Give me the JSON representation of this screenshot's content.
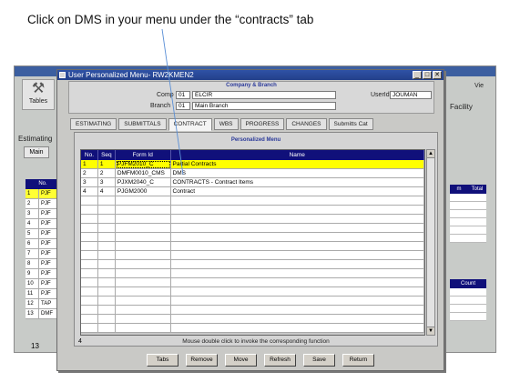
{
  "instruction": "Click on DMS in your menu under the “contracts” tab",
  "background_app": {
    "tables_label": "Tables",
    "estimating_label": "Estimating",
    "main_tab": "Main",
    "vie_label": "Vie",
    "facility_label": "Facility",
    "grid_header": "No.",
    "rows": [
      {
        "no": "1",
        "id": "PJF"
      },
      {
        "no": "2",
        "id": "PJF"
      },
      {
        "no": "3",
        "id": "PJF"
      },
      {
        "no": "4",
        "id": "PJF"
      },
      {
        "no": "5",
        "id": "PJF"
      },
      {
        "no": "6",
        "id": "PJF"
      },
      {
        "no": "7",
        "id": "PJF"
      },
      {
        "no": "8",
        "id": "PJF"
      },
      {
        "no": "9",
        "id": "PJF"
      },
      {
        "no": "10",
        "id": "PJF"
      },
      {
        "no": "11",
        "id": "PJF"
      },
      {
        "no": "12",
        "id": "TAP"
      },
      {
        "no": "13",
        "id": "DMF"
      }
    ],
    "count": "13",
    "right_col_header_a": "m",
    "right_col_header_b": "Total",
    "right_col2_header": "Count"
  },
  "dialog": {
    "title": "User Personalized Menu- RW2KMEN2",
    "company_branch_header": "Company & Branch",
    "comp_label": "Comp",
    "comp_code": "01",
    "comp_name": "ELCIR",
    "branch_label": "Branch",
    "branch_code": "01",
    "branch_name": "Main Branch",
    "userid_label": "UserId",
    "userid_value": "JOUMAN",
    "tabs": [
      {
        "label": "ESTIMATING"
      },
      {
        "label": "SUBMITTALS"
      },
      {
        "label": "CONTRACT"
      },
      {
        "label": "WBS"
      },
      {
        "label": "PROGRESS"
      },
      {
        "label": "CHANGES"
      },
      {
        "label": "Submitts Cat"
      }
    ],
    "active_tab": "CONTRACT",
    "personalized_menu_header": "Personalized Menu",
    "columns": {
      "no": "No.",
      "seq": "Seq",
      "form_id": "Form Id",
      "name": "Name"
    },
    "rows": [
      {
        "no": "1",
        "seq": "1",
        "form_id": "PJFM2010_C",
        "name": "Partial Contracts"
      },
      {
        "no": "2",
        "seq": "2",
        "form_id": "DMFM0010_CMS",
        "name": "DMS"
      },
      {
        "no": "3",
        "seq": "3",
        "form_id": "PJXM2040_C",
        "name": "CONTRACTS - Contract Items"
      },
      {
        "no": "4",
        "seq": "4",
        "form_id": "PJGM2000",
        "name": "Contract"
      }
    ],
    "row_count": "4",
    "hint": "Mouse double click to invoke the corresponding function",
    "buttons": {
      "tabs": "Tabs",
      "remove": "Remove",
      "move": "Move",
      "refresh": "Refresh",
      "save": "Save",
      "return": "Return"
    }
  },
  "colors": {
    "title_bar": "#2f52a6",
    "grid_header": "#10107a",
    "selected_row": "#ffff00",
    "instruction_line": "#5a8fd6"
  },
  "icons": [
    "hammer-icon",
    "close-icon",
    "minimize-icon",
    "maximize-icon",
    "scroll-up-icon",
    "scroll-down-icon",
    "pointer-line-icon"
  ]
}
